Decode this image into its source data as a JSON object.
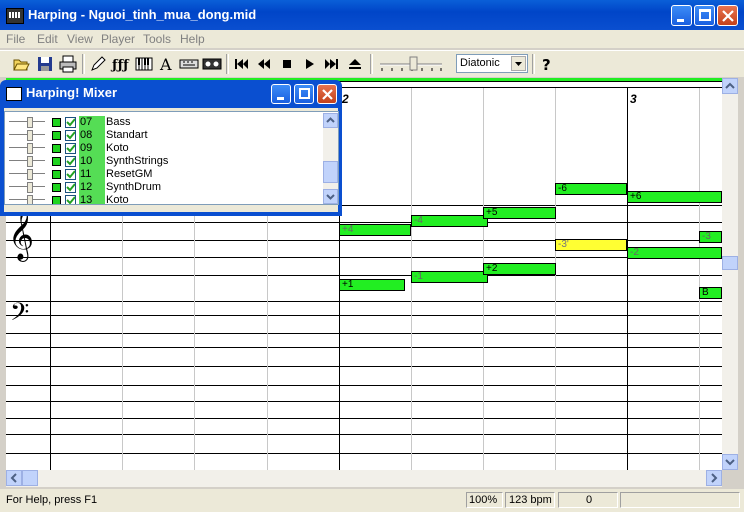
{
  "window": {
    "title": "Harping - Nguoi_tinh_mua_dong.mid"
  },
  "menu": [
    "File",
    "Edit",
    "View",
    "Player",
    "Tools",
    "Help"
  ],
  "toolbar": {
    "mode_value": "Diatonic",
    "icons": [
      "open-icon",
      "save-icon",
      "print-icon",
      "pencil-icon",
      "harmonica-icon",
      "piano-icon",
      "text-icon",
      "keyboard-icon",
      "tape-icon",
      "skip-start-icon",
      "rewind-icon",
      "stop-icon",
      "play-icon",
      "skip-end-icon",
      "eject-icon",
      "volume-slider",
      "help-icon"
    ]
  },
  "score": {
    "measures": [
      "2",
      "3"
    ],
    "notes": [
      {
        "label": "-6",
        "style": "green"
      },
      {
        "label": "+6",
        "style": "green"
      },
      {
        "label": "-4",
        "style": "green"
      },
      {
        "label": "+5",
        "style": "green"
      },
      {
        "label": "+4",
        "style": "green"
      },
      {
        "label": "-3'",
        "style": "yellow"
      },
      {
        "label": "-3",
        "style": "green"
      },
      {
        "label": "-2",
        "style": "green"
      },
      {
        "label": "-1",
        "style": "green"
      },
      {
        "label": "+2",
        "style": "green"
      },
      {
        "label": "+1",
        "style": "green"
      },
      {
        "label": "B",
        "style": "green"
      }
    ]
  },
  "mixer": {
    "title": "Harping! Mixer",
    "channels": [
      {
        "num": "07",
        "name": "Bass",
        "checked": true
      },
      {
        "num": "08",
        "name": "Standart",
        "checked": true
      },
      {
        "num": "09",
        "name": "Koto",
        "checked": true
      },
      {
        "num": "10",
        "name": "SynthStrings",
        "checked": true
      },
      {
        "num": "11",
        "name": "ResetGM",
        "checked": true
      },
      {
        "num": "12",
        "name": "SynthDrum",
        "checked": true
      },
      {
        "num": "13",
        "name": "Koto",
        "checked": true
      }
    ]
  },
  "status": {
    "help": "For Help, press F1",
    "zoom": "100%",
    "tempo": "123 bpm",
    "position": "0"
  },
  "colors": {
    "note_green": "#22ee22",
    "note_yellow": "#ffff33",
    "titlebar": "#0a4fd0"
  }
}
